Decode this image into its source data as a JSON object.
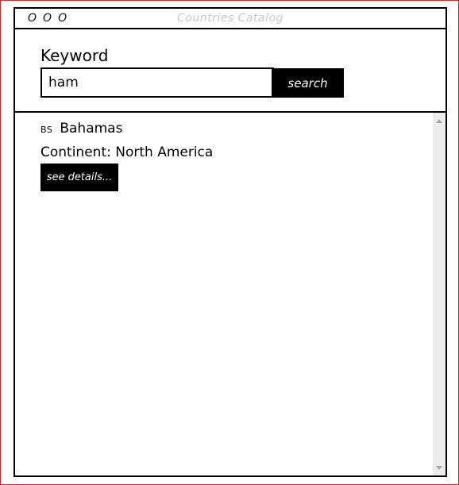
{
  "window": {
    "title": "Countries Catalog",
    "controls": [
      "O",
      "O",
      "O"
    ]
  },
  "search": {
    "label": "Keyword",
    "value": "ham",
    "placeholder": "",
    "button_label": "search"
  },
  "results": [
    {
      "code": "BS",
      "name": "Bahamas",
      "continent_label": "Continent:",
      "continent": "North America",
      "details_label": "see details..."
    }
  ],
  "colors": {
    "frame": "#d3262a",
    "title_text": "#c8c8c8",
    "button_bg": "#000000",
    "button_text": "#ffffff",
    "scrollbar_track": "#ececec"
  },
  "icons": {
    "scroll_up": "scroll-up-arrow-icon",
    "scroll_down": "scroll-down-arrow-icon"
  }
}
